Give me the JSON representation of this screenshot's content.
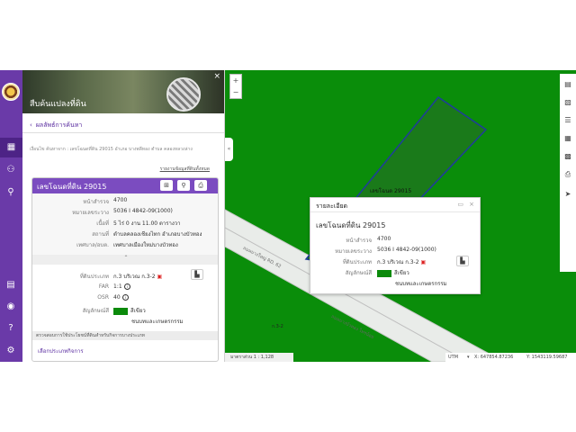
{
  "panel": {
    "title": "สืบค้นแปลงที่ดิน",
    "close": "×",
    "back_label": "ผลลัพธ์การค้นหา",
    "context_text": "เงื่อนไข ค้นหาจาก : เลขโฉนดที่ดิน 29015 อำเภอ บางพลีทอง ตำบล คลองหลวงล่าง",
    "report_link": "รายงานข้อมูลที่ดินทั้งหมด",
    "card": {
      "title": "เลขโฉนดที่ดิน 29015",
      "rows": [
        {
          "key": "หน้าสำรวจ",
          "value": "4700"
        },
        {
          "key": "หมายเลขระวาง",
          "value": "5036 I 4842-09(1000)"
        },
        {
          "key": "เนื้อที่",
          "value": "5 ไร่ 0 งาน 11.00 ตารางวา"
        },
        {
          "key": "สถานที่",
          "value": "ตำบลคลองเชียงไทก อำเภอบางบัวทอง"
        },
        {
          "key": "เทศบาล/อบต.",
          "value": "เทศบาลเมืองใหม่บางบัวทอง"
        }
      ],
      "zoning_key": "ที่ดินประเภท",
      "zoning_value": "ก.3 บริเวณ ก.3-2",
      "far_key": "FAR",
      "far_value": "1:1",
      "osr_key": "OSR",
      "osr_value": "40",
      "color_key": "สัญลักษณ์สี",
      "color_value": "สีเขียว",
      "color_desc": "ชนบทและเกษตรกรรม",
      "check_bar": "ตรวจสอบการใช้ประโยชน์ที่ดินสำหรับกิจการบางประเภท",
      "choose_label": "เลือกประเภทกิจการ"
    }
  },
  "map": {
    "zoom_in": "+",
    "zoom_out": "−",
    "handle": "«",
    "parcel_label": "เลขโฉนด 29015",
    "road_label1": "ถนนบางใหญ่ RD. 62",
    "road_label2": "ถนนบางบัวทอง ไทรน้อย",
    "small_label": "ก.3-2",
    "scale_text": "มาตราส่วน 1 : 1,128",
    "coord_system": "UTM",
    "coord_x": "X: 647854.87236",
    "coord_y": "Y: 1543119.59687"
  },
  "popup": {
    "header": "รายละเอียด",
    "title": "เลขโฉนดที่ดิน 29015",
    "rows": [
      {
        "key": "หน้าสำรวจ",
        "value": "4700"
      },
      {
        "key": "หมายเลขระวาง",
        "value": "5036 I 4842-09(1000)"
      }
    ],
    "zoning_key": "ที่ดินประเภท",
    "zoning_value": "ก.3 บริเวณ ก.3-2",
    "color_key": "สัญลักษณ์สี",
    "color_value": "สีเขียว",
    "color_desc": "ชนบทและเกษตรกรรม"
  },
  "colors": {
    "brand_purple": "#6a3aa8",
    "map_green": "#0a8d0a",
    "parcel_green": "#1a7a1a",
    "parcel_outline": "#1f3c9c",
    "swatch_green": "#0b8a0b"
  }
}
